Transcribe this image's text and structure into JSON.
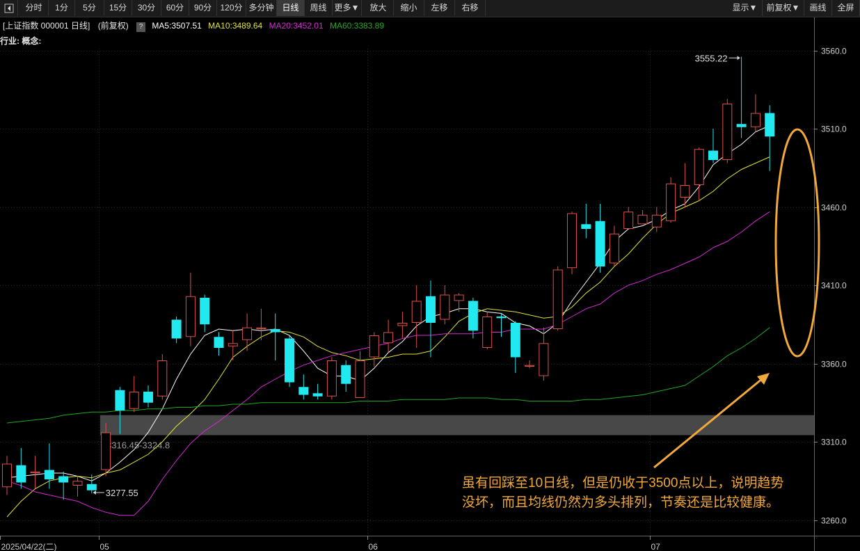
{
  "toolbar": {
    "nav_icon": "collapse-left-icon",
    "periods": [
      "分时",
      "1分",
      "5分",
      "15分",
      "30分",
      "60分",
      "90分",
      "120分",
      "多分钟",
      "日线",
      "周线",
      "更多▼"
    ],
    "active_period": "日线",
    "tools": [
      "放大",
      "缩小",
      "左移",
      "右移"
    ],
    "right": [
      "显示▼",
      "前复权▼",
      "画线",
      "全屏"
    ]
  },
  "info": {
    "security": "[上证指数 000001 日线]",
    "adjust": "(前复权)",
    "help": "?",
    "ma5": "MA5:3507.51",
    "ma10": "MA10:3489.64",
    "ma20": "MA20:3452.01",
    "ma60": "MA60:3383.89"
  },
  "industry_label": "行业: 概念:",
  "annotation_text": "虽有回踩至10日线，但是仍收于3500点以上，说明趋势没坏，而且均线仍然为多头排列，节奏还是比较健康。",
  "colors": {
    "up": "#e0504a",
    "down": "#22e8f0",
    "ma5": "#ffffff",
    "ma10": "#e4e43a",
    "ma20": "#d42ad4",
    "ma60": "#22aa22",
    "annotation": "#f2a93b"
  },
  "chart_data": {
    "type": "candlestick",
    "ylim": [
      3250,
      3570
    ],
    "y_ticks": [
      "3560.0",
      "3510.0",
      "3460.0",
      "3410.0",
      "3360.0",
      "3310.0",
      "3260.0"
    ],
    "y_tick_values": [
      3560,
      3510,
      3460,
      3410,
      3360,
      3310,
      3260
    ],
    "x_labels": [
      {
        "label": "2025/04/22(二)",
        "index": 0
      },
      {
        "label": "05",
        "index": 7
      },
      {
        "label": "06",
        "index": 26
      },
      {
        "label": "07",
        "index": 46
      }
    ],
    "candles": [
      [
        3281,
        3296,
        3276,
        3301
      ],
      [
        3295,
        3284,
        3280,
        3306
      ],
      [
        3290,
        3291,
        3280,
        3301
      ],
      [
        3292,
        3286,
        3280,
        3309
      ],
      [
        3288,
        3284,
        3273,
        3291
      ],
      [
        3282,
        3285,
        3275,
        3288
      ],
      [
        3283,
        3279,
        3277,
        3289
      ],
      [
        3292,
        3316,
        3288,
        3322
      ],
      [
        3343,
        3330,
        3315,
        3345
      ],
      [
        3331,
        3342,
        3329,
        3352
      ],
      [
        3342,
        3335,
        3332,
        3346
      ],
      [
        3339,
        3362,
        3337,
        3366
      ],
      [
        3388,
        3376,
        3373,
        3390
      ],
      [
        3377,
        3403,
        3371,
        3418
      ],
      [
        3402,
        3385,
        3380,
        3404
      ],
      [
        3377,
        3370,
        3365,
        3380
      ],
      [
        3371,
        3373,
        3362,
        3381
      ],
      [
        3375,
        3383,
        3368,
        3392
      ],
      [
        3382,
        3383,
        3375,
        3395
      ],
      [
        3382,
        3380,
        3362,
        3392
      ],
      [
        3376,
        3348,
        3345,
        3378
      ],
      [
        3345,
        3340,
        3337,
        3353
      ],
      [
        3341,
        3339,
        3337,
        3347
      ],
      [
        3339,
        3362,
        3337,
        3364
      ],
      [
        3359,
        3347,
        3342,
        3362
      ],
      [
        3338,
        3362,
        3338,
        3368
      ],
      [
        3364,
        3378,
        3358,
        3380
      ],
      [
        3373,
        3380,
        3367,
        3388
      ],
      [
        3384,
        3386,
        3376,
        3393
      ],
      [
        3386,
        3400,
        3370,
        3410
      ],
      [
        3403,
        3386,
        3364,
        3413
      ],
      [
        3388,
        3404,
        3385,
        3410
      ],
      [
        3400,
        3404,
        3393,
        3405
      ],
      [
        3400,
        3381,
        3376,
        3402
      ],
      [
        3370,
        3390,
        3369,
        3393
      ],
      [
        3390,
        3389,
        3377,
        3392
      ],
      [
        3386,
        3364,
        3354,
        3387
      ],
      [
        3358,
        3359,
        3357,
        3362
      ],
      [
        3352,
        3373,
        3349,
        3383
      ],
      [
        3382,
        3420,
        3381,
        3422
      ],
      [
        3421,
        3456,
        3417,
        3457
      ],
      [
        3449,
        3446,
        3440,
        3462
      ],
      [
        3451,
        3422,
        3418,
        3462
      ],
      [
        3424,
        3443,
        3422,
        3448
      ],
      [
        3446,
        3457,
        3446,
        3460
      ],
      [
        3449,
        3455,
        3450,
        3458
      ],
      [
        3447,
        3455,
        3444,
        3460
      ],
      [
        3451,
        3475,
        3450,
        3479
      ],
      [
        3466,
        3474,
        3460,
        3488
      ],
      [
        3474,
        3497,
        3464,
        3498
      ],
      [
        3496,
        3490,
        3488,
        3510
      ],
      [
        3490,
        3526,
        3488,
        3529
      ],
      [
        3513,
        3511,
        3504,
        3556
      ],
      [
        3511,
        3520,
        3508,
        3532
      ],
      [
        3520,
        3505,
        3483,
        3525
      ]
    ],
    "series": [
      {
        "name": "MA5",
        "values": [
          3287,
          3288,
          3289,
          3290,
          3290,
          3288,
          3285,
          3290,
          3297,
          3305,
          3316,
          3331,
          3350,
          3366,
          3378,
          3382,
          3381,
          3382,
          3381,
          3382,
          3378,
          3368,
          3357,
          3352,
          3352,
          3349,
          3357,
          3367,
          3374,
          3384,
          3390,
          3392,
          3395,
          3395,
          3393,
          3392,
          3386,
          3384,
          3379,
          3386,
          3400,
          3412,
          3424,
          3438,
          3446,
          3448,
          3452,
          3458,
          3462,
          3473,
          3487,
          3494,
          3500,
          3508,
          3512
        ]
      },
      {
        "name": "MA10",
        "values": [
          3262,
          3272,
          3280,
          3285,
          3287,
          3288,
          3287,
          3290,
          3292,
          3297,
          3302,
          3310,
          3320,
          3328,
          3337,
          3350,
          3364,
          3371,
          3377,
          3381,
          3380,
          3377,
          3371,
          3367,
          3365,
          3362,
          3363,
          3364,
          3366,
          3366,
          3368,
          3377,
          3387,
          3392,
          3395,
          3394,
          3393,
          3391,
          3389,
          3390,
          3396,
          3405,
          3412,
          3422,
          3430,
          3440,
          3449,
          3456,
          3460,
          3464,
          3470,
          3478,
          3484,
          3488,
          3492
        ]
      },
      {
        "name": "MA20",
        "values": [
          3285,
          3282,
          3278,
          3276,
          3274,
          3272,
          3268,
          3265,
          3263,
          3263,
          3272,
          3286,
          3298,
          3309,
          3317,
          3323,
          3330,
          3337,
          3345,
          3350,
          3355,
          3359,
          3362,
          3365,
          3367,
          3369,
          3371,
          3373,
          3376,
          3378,
          3378,
          3379,
          3379,
          3379,
          3380,
          3380,
          3382,
          3382,
          3382,
          3385,
          3390,
          3395,
          3398,
          3405,
          3410,
          3413,
          3417,
          3420,
          3424,
          3428,
          3434,
          3438,
          3444,
          3451,
          3457
        ]
      },
      {
        "name": "MA60",
        "values": [
          3322,
          3323,
          3324,
          3325,
          3327,
          3328,
          3329,
          3329,
          3330,
          3330,
          3331,
          3331,
          3332,
          3332,
          3333,
          3333,
          3334,
          3334,
          3335,
          3335,
          3335,
          3335,
          3335,
          3335,
          3335,
          3336,
          3336,
          3336,
          3337,
          3337,
          3337,
          3337,
          3338,
          3338,
          3338,
          3337,
          3337,
          3336,
          3336,
          3336,
          3336,
          3337,
          3337,
          3338,
          3339,
          3340,
          3342,
          3344,
          3346,
          3352,
          3358,
          3365,
          3370,
          3376,
          3383
        ]
      }
    ],
    "annotations": {
      "high_label": "3555.22",
      "high_index": 52,
      "high_value": 3555.22,
      "low_label": "3277.55",
      "low_index": 6,
      "low_value": 3277.55,
      "gap_label": "3316.45-3324.8",
      "gap_range": [
        3316.45,
        3324.8
      ],
      "gap_start_index": 7
    }
  }
}
